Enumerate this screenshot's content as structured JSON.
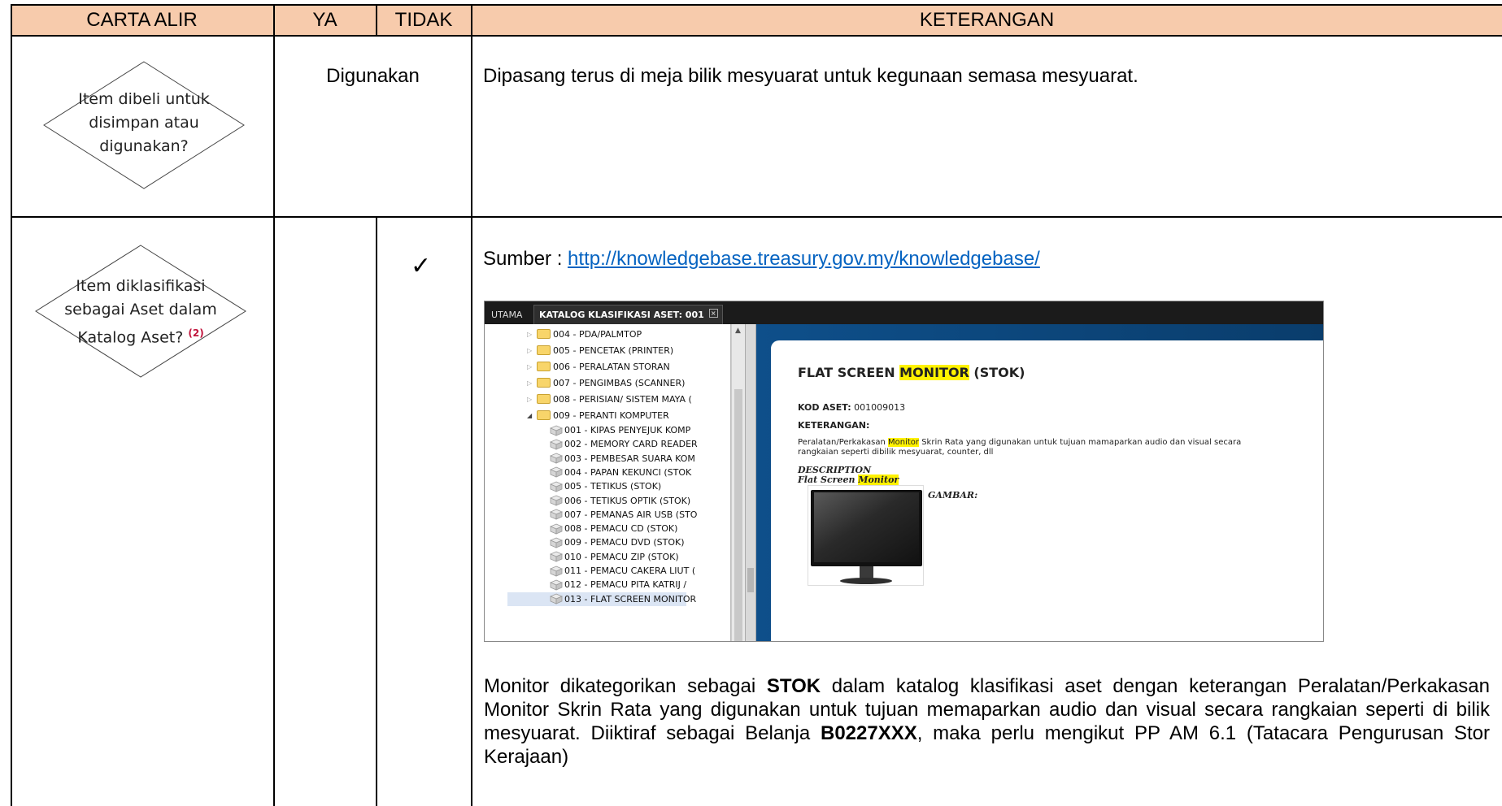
{
  "header": {
    "col_carta": "CARTA ALIR",
    "col_ya": "YA",
    "col_tidak": "TIDAK",
    "col_keterangan": "KETERANGAN",
    "bg_color": "#f7cbac"
  },
  "row1": {
    "diamond_lines": [
      "Item dibeli untuk",
      "disimpan atau",
      "digunakan?"
    ],
    "answer": "Digunakan",
    "keterangan": "Dipasang terus di meja bilik mesyuarat untuk kegunaan semasa mesyuarat."
  },
  "row2": {
    "diamond_lines": [
      "Item diklasifikasi",
      "sebagai Aset dalam",
      "Katalog Aset?"
    ],
    "diamond_note": "(2)",
    "tidak_mark": "✓",
    "source_label": "Sumber : ",
    "source_link": "http://knowledgebase.treasury.gov.my/knowledgebase/",
    "paragraph": {
      "p1": "Monitor dikategorikan sebagai ",
      "b1": "STOK",
      "p2": " dalam katalog klasifikasi aset dengan keterangan Peralatan/Perkakasan Monitor Skrin Rata yang digunakan untuk tujuan memaparkan audio dan visual secara rangkaian seperti di bilik mesyuarat. Diiktiraf sebagai Belanja ",
      "b2": "B0227XXX",
      "p3": ", maka perlu mengikut PP AM 6.1 (Tatacara Pengurusan Stor Kerajaan)"
    }
  },
  "catalog": {
    "tab_utama": "UTAMA",
    "tab_active": "KATALOG KLASIFIKASI ASET: 001",
    "folders": [
      "004 - PDA/PALMTOP",
      "005 - PENCETAK (PRINTER)",
      "006 - PERALATAN STORAN",
      "007 - PENGIMBAS (SCANNER)",
      "008 - PERISIAN/ SISTEM MAYA (",
      "009 - PERANTI KOMPUTER"
    ],
    "items": [
      "001 - KIPAS PENYEJUK KOMP",
      "002 - MEMORY CARD READER",
      "003 - PEMBESAR SUARA KOM",
      "004 - PAPAN KEKUNCI (STOK",
      "005 - TETIKUS (STOK)",
      "006 - TETIKUS OPTIK (STOK)",
      "007 - PEMANAS AIR USB (STO",
      "008 - PEMACU CD (STOK)",
      "009 - PEMACU DVD (STOK)",
      "010 - PEMACU ZIP (STOK)",
      "011 - PEMACU CAKERA LIUT (",
      "012 - PEMACU PITA KATRIJ /",
      "013 - FLAT SCREEN MONITOR"
    ],
    "detail": {
      "title_pre": "FLAT SCREEN ",
      "title_hl": "MONITOR",
      "title_post": " (STOK)",
      "kod_label": "KOD ASET:",
      "kod_value": "001009013",
      "keterangan_label": "KETERANGAN:",
      "desc_pre": "Peralatan/Perkakasan ",
      "desc_hl": "Monitor",
      "desc_post1": " Skrin Rata yang digunakan untuk tujuan mamaparkan audio dan visual secara",
      "desc_line2": "rangkaian seperti dibilik mesyuarat, counter, dll",
      "description_label": "DESCRIPTION",
      "description_pre": "Flat Screen ",
      "description_hl": "Monitor",
      "gambar_label": "GAMBAR:"
    }
  }
}
